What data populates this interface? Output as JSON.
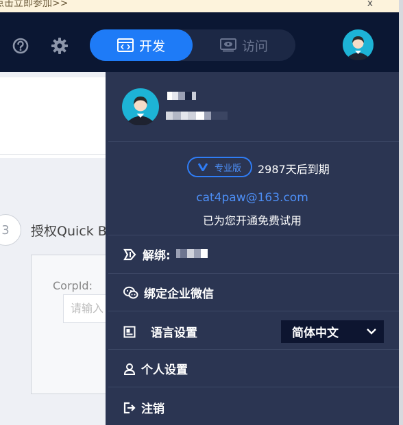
{
  "banner": {
    "text": "点击立即参加>>",
    "close_label": "x"
  },
  "header": {
    "mode_toggle": {
      "dev_label": "开发",
      "visit_label": "访问"
    },
    "icons": {
      "help": "help-circle-icon",
      "settings": "gear-icon",
      "dev": "code-window-icon",
      "visit": "eye-window-icon"
    }
  },
  "background_page": {
    "step_number": "3",
    "step_title": "授权Quick B",
    "corp_label": "CorpId:",
    "corp_placeholder": "请输入"
  },
  "account_panel": {
    "plan_label": "专业版",
    "expire_text": "2987天后到期",
    "email": "cat4paw@163.com",
    "trial_text": "已为您开通免费试用",
    "menu": {
      "unbind_label": "解绑:",
      "bind_wechat_label": "绑定企业微信",
      "language_label": "语言设置",
      "language_value": "简体中文",
      "personal_settings_label": "个人设置",
      "logout_label": "注销"
    }
  },
  "colors": {
    "header_bg": "#0b1733",
    "panel_bg": "#2b3552",
    "accent": "#1e7bf7",
    "link": "#4d8ff7"
  }
}
